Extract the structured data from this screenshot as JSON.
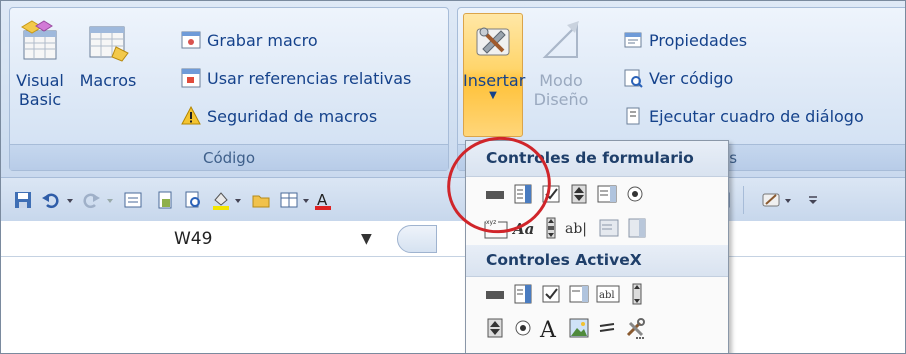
{
  "ribbon": {
    "codigo_group": {
      "label": "Código",
      "visual_basic": "Visual\nBasic",
      "macros": "Macros",
      "grabar_macro": "Grabar macro",
      "usar_referencias": "Usar referencias relativas",
      "seguridad": "Seguridad de macros"
    },
    "controles_group": {
      "insertar": "Insertar",
      "modo_diseno": "Modo\nDiseño",
      "propiedades": "Propiedades",
      "ver_codigo": "Ver código",
      "ejecutar": "Ejecutar cuadro de diálogo",
      "label_fragment": "es"
    }
  },
  "formula_bar": {
    "name_box": "W49"
  },
  "insert_dropdown": {
    "form_header": "Controles de formulario",
    "activex_header": "Controles ActiveX"
  },
  "colors": {
    "ribbon_text": "#15428b",
    "highlight": "#ffd56b",
    "annotation_circle": "#d0252a"
  }
}
